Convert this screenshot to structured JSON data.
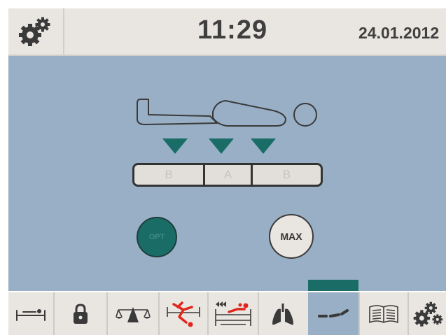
{
  "header": {
    "time": "11:29",
    "date": "24.01.2012",
    "settings_icon": "gears-icon"
  },
  "main": {
    "zones": [
      {
        "label": "B"
      },
      {
        "label": "A"
      },
      {
        "label": "B"
      }
    ],
    "opt_button_label": "OPT",
    "max_button_label": "MAX"
  },
  "colors": {
    "header_bg": "#e9e6e1",
    "panel_bg": "#98afc6",
    "accent_teal": "#1a6d66",
    "alert_red": "#e0251b"
  },
  "nav": {
    "items": [
      {
        "icon": "bed-flat-icon"
      },
      {
        "icon": "lock-icon"
      },
      {
        "icon": "scale-icon"
      },
      {
        "icon": "patient-fall-alarm-icon"
      },
      {
        "icon": "bed-exit-icon"
      },
      {
        "icon": "lungs-icon"
      },
      {
        "icon": "mattress-therapy-icon",
        "active": true
      },
      {
        "icon": "manual-book-icon"
      },
      {
        "icon": "gears-icon"
      }
    ]
  }
}
